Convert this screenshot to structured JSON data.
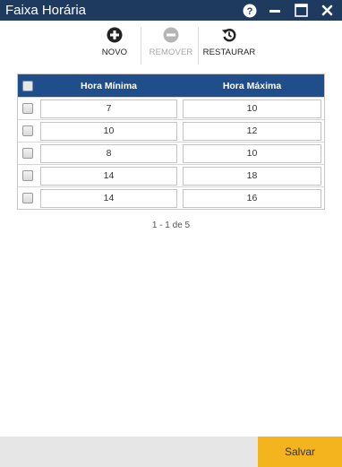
{
  "window": {
    "title": "Faixa Horária",
    "controls": [
      "help-icon",
      "minimize-icon",
      "maximize-icon",
      "close-icon"
    ]
  },
  "toolbar": {
    "novo": {
      "label": "NOVO",
      "icon": "add-circle-icon"
    },
    "remover": {
      "label": "REMOVER",
      "icon": "remove-circle-icon",
      "disabled": true
    },
    "restaurar": {
      "label": "RESTAURAR",
      "icon": "restore-icon"
    }
  },
  "grid": {
    "columns": [
      "Hora Mínima",
      "Hora Máxima"
    ],
    "rows": [
      {
        "min": "7",
        "max": "10"
      },
      {
        "min": "10",
        "max": "12"
      },
      {
        "min": "8",
        "max": "10"
      },
      {
        "min": "14",
        "max": "18"
      },
      {
        "min": "14",
        "max": "16"
      }
    ]
  },
  "pager": {
    "text": "1 - 1 de 5"
  },
  "footer": {
    "save_label": "Salvar"
  },
  "colors": {
    "titlebar": "#1f3a5f",
    "grid_header": "#1f4e8a",
    "save_button": "#f4b41e",
    "footer": "#e6e6e6"
  }
}
